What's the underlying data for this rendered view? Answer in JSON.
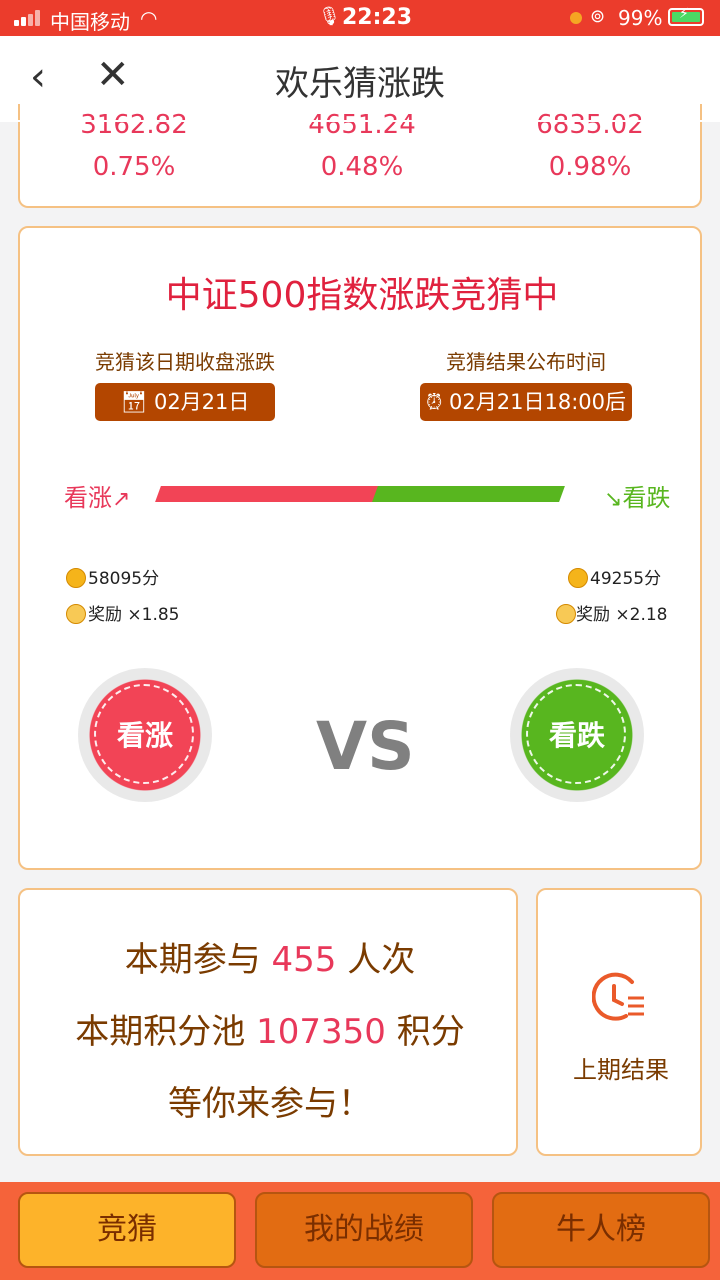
{
  "status_bar": {
    "carrier": "中国移动",
    "time": "22:23",
    "battery": "99%"
  },
  "nav": {
    "title": "欢乐猜涨跌"
  },
  "indices": [
    {
      "value": "3162.82",
      "change": "0.75%"
    },
    {
      "value": "4651.24",
      "change": "0.48%"
    },
    {
      "value": "6835.02",
      "change": "0.98%"
    }
  ],
  "guess": {
    "title": "中证500指数涨跌竞猜中",
    "date_label": "竞猜该日期收盘涨跌",
    "date_value": "02月21日",
    "result_label": "竞猜结果公布时间",
    "result_value": "02月21日18:00后",
    "up_label": "看涨",
    "down_label": "看跌",
    "up_share": 0.54,
    "up_points": "58095分",
    "down_points": "49255分",
    "up_reward": "奖励 ×1.85",
    "down_reward": "奖励 ×2.18",
    "up_button": "看涨",
    "down_button": "看跌",
    "vs": "VS",
    "colors": {
      "up": "#f24456",
      "down": "#58b61f"
    }
  },
  "summary": {
    "line1_prefix": "本期参与",
    "participants": "455",
    "line1_suffix": "人次",
    "line2_prefix": "本期积分池",
    "pool": "107350",
    "line2_suffix": "积分",
    "line3": "等你来参与！"
  },
  "history": {
    "label": "上期结果",
    "icon": "clock-list-icon"
  },
  "tabs": [
    {
      "label": "竞猜",
      "active": true
    },
    {
      "label": "我的战绩",
      "active": false
    },
    {
      "label": "牛人榜",
      "active": false
    }
  ]
}
